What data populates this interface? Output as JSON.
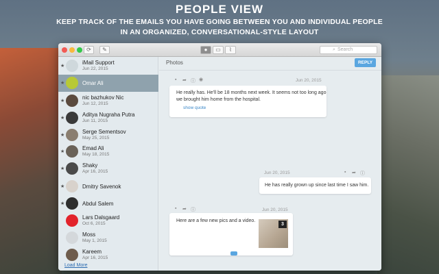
{
  "banner": {
    "title": "PEOPLE VIEW",
    "line1": "KEEP TRACK OF THE EMAILS YOU HAVE GOING BETWEEN YOU AND INDIVIDUAL PEOPLE",
    "line2": "IN AN ORGANIZED, CONVERSATIONAL-STYLE LAYOUT"
  },
  "toolbar": {
    "search_placeholder": "Search"
  },
  "sidebar": {
    "items": [
      {
        "name": "iMail Support",
        "date": "Jun 22, 2015",
        "starred": true
      },
      {
        "name": "Omar Ali",
        "date": "",
        "starred": true,
        "selected": true
      },
      {
        "name": "nic bazhukov Nic",
        "date": "Jun 12, 2015",
        "starred": true
      },
      {
        "name": "Aditya Nugraha Putra",
        "date": "Jun 11, 2015",
        "starred": true
      },
      {
        "name": "Serge Sementsov",
        "date": "May 25, 2015",
        "starred": true
      },
      {
        "name": "Emad Ali",
        "date": "May 18, 2015",
        "starred": true
      },
      {
        "name": "Shaky",
        "date": "Apr 16, 2015",
        "starred": true
      },
      {
        "name": "Dmitry Savenok",
        "date": "",
        "starred": true
      },
      {
        "name": "Abdul Salem",
        "date": "",
        "starred": true
      },
      {
        "name": "Lars Dalsgaard",
        "date": "Oct 6, 2015",
        "starred": false
      },
      {
        "name": "Moss",
        "date": "May 1, 2015",
        "starred": false
      },
      {
        "name": "Kareem",
        "date": "Apr 16, 2015",
        "starred": false
      }
    ],
    "load_more": "Load More"
  },
  "main": {
    "subject": "Photos",
    "reply_label": "REPLY",
    "messages": [
      {
        "date": "Jun 20, 2015",
        "line1": "He really has. He'll be 18 months next week. It seems not too long ago",
        "line2": "we brought him home from the hospital.",
        "show_quote": "show quote"
      },
      {
        "date": "Jun 20, 2015",
        "line1": "He has really grown up since last time I saw him."
      },
      {
        "date": "Jun 20, 2015",
        "line1": "Here are a few new pics and a video.",
        "attachment_count": "3"
      }
    ]
  },
  "colors": {
    "accent": "#5aa6e0",
    "selected_row": "#8fa2ad"
  }
}
